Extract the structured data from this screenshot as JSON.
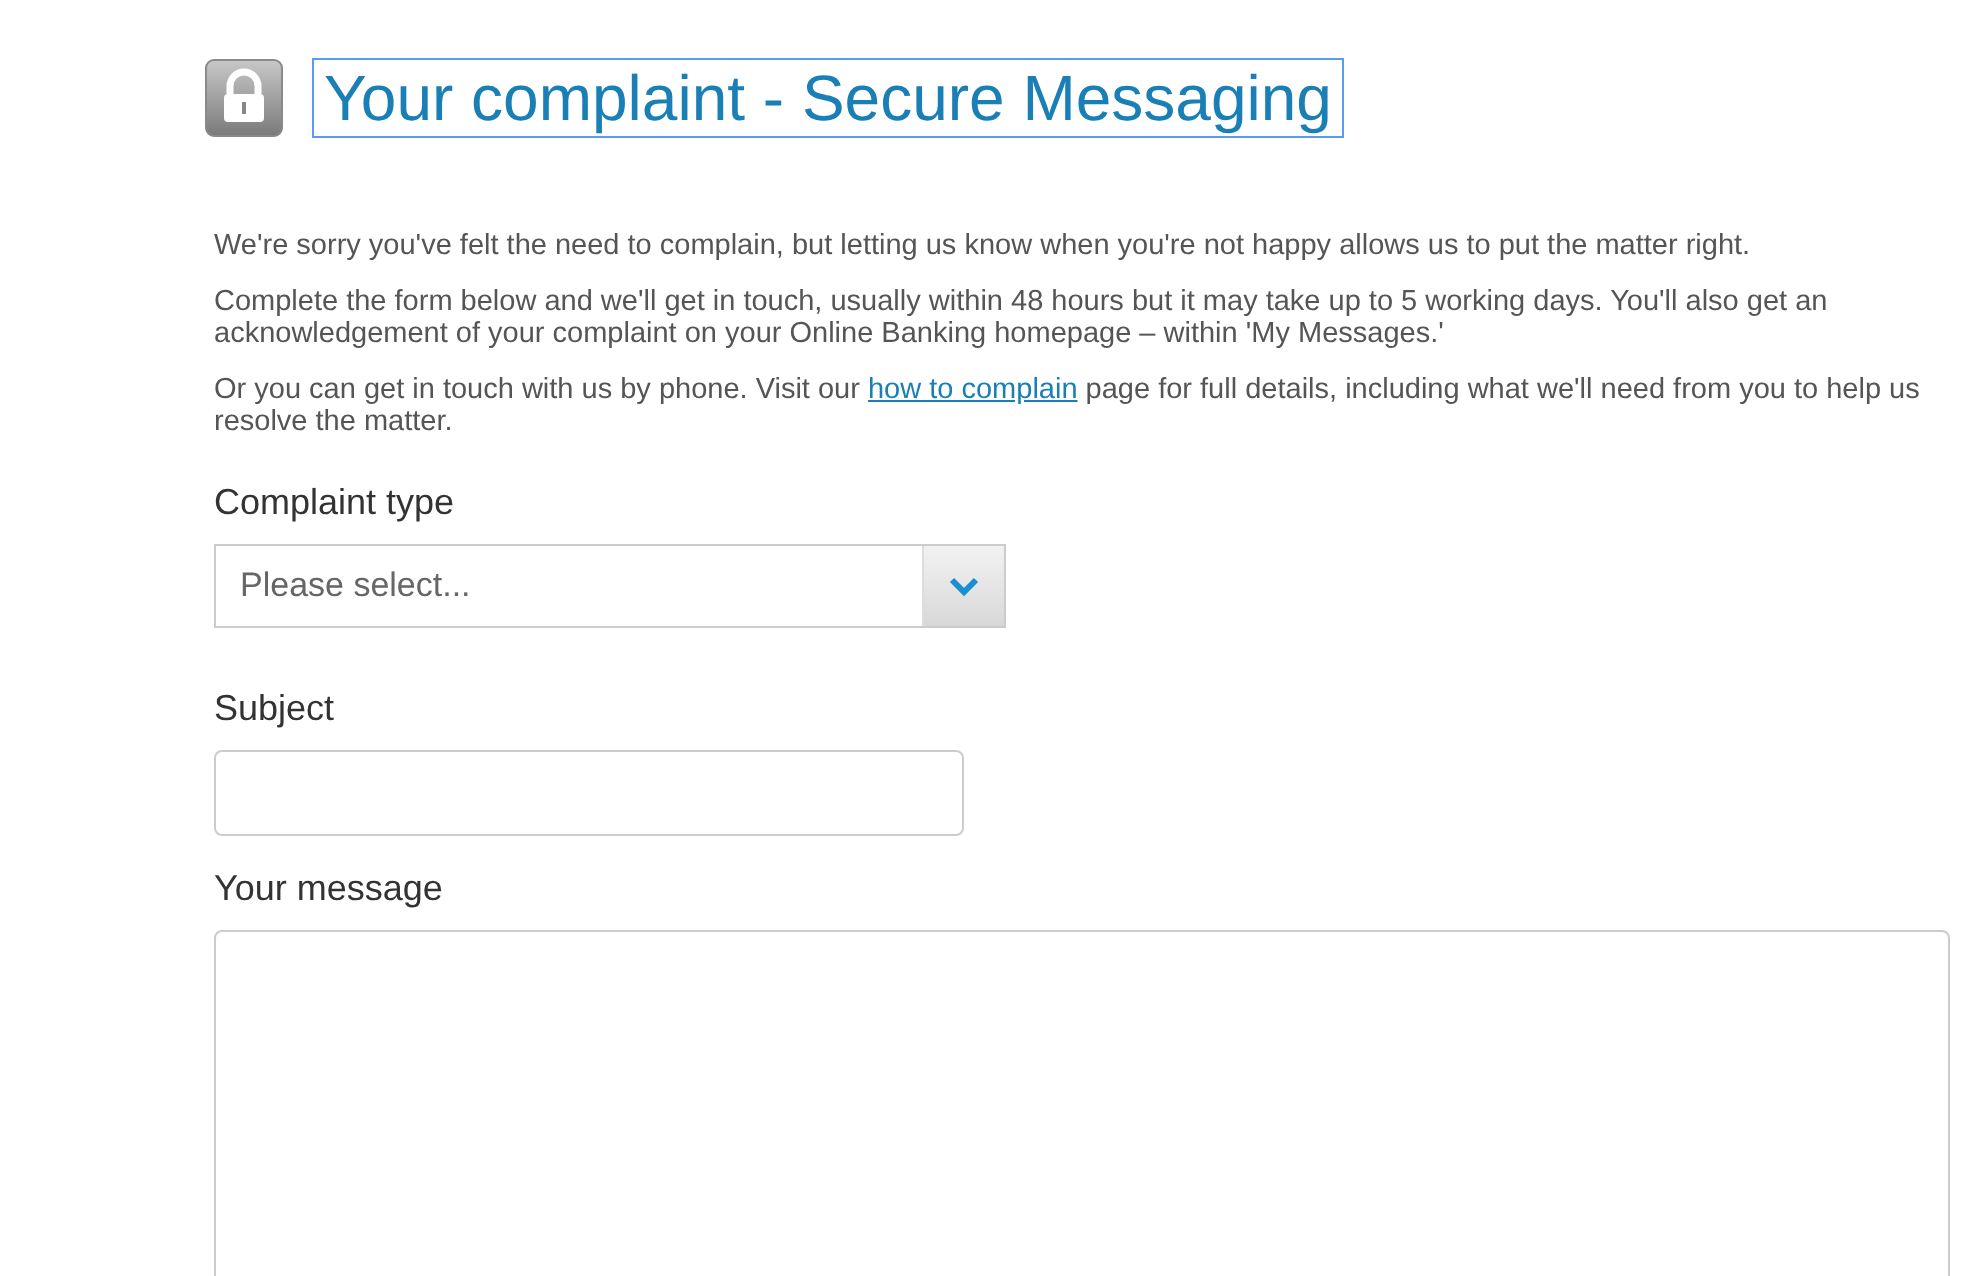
{
  "header": {
    "title": "Your complaint - Secure Messaging"
  },
  "paragraphs": [
    {
      "before": "We're sorry you've felt the need to complain, but letting us know when you're not happy allows us to put the matter right."
    },
    {
      "before": "Complete the form below and we'll get in touch, usually within 48 hours but it may take up to 5 working days. You'll also get an acknowledgement of your complaint on your Online Banking homepage – within 'My Messages.'"
    },
    {
      "before": "Or you can get in touch with us by phone. Visit our ",
      "link": "how to complain",
      "after": " page for full details, including what we'll need from you to help us resolve the matter."
    }
  ],
  "form": {
    "complaint_type": {
      "label": "Complaint type",
      "placeholder": "Please select..."
    },
    "subject": {
      "label": "Subject"
    },
    "message": {
      "label": "Your message"
    }
  }
}
